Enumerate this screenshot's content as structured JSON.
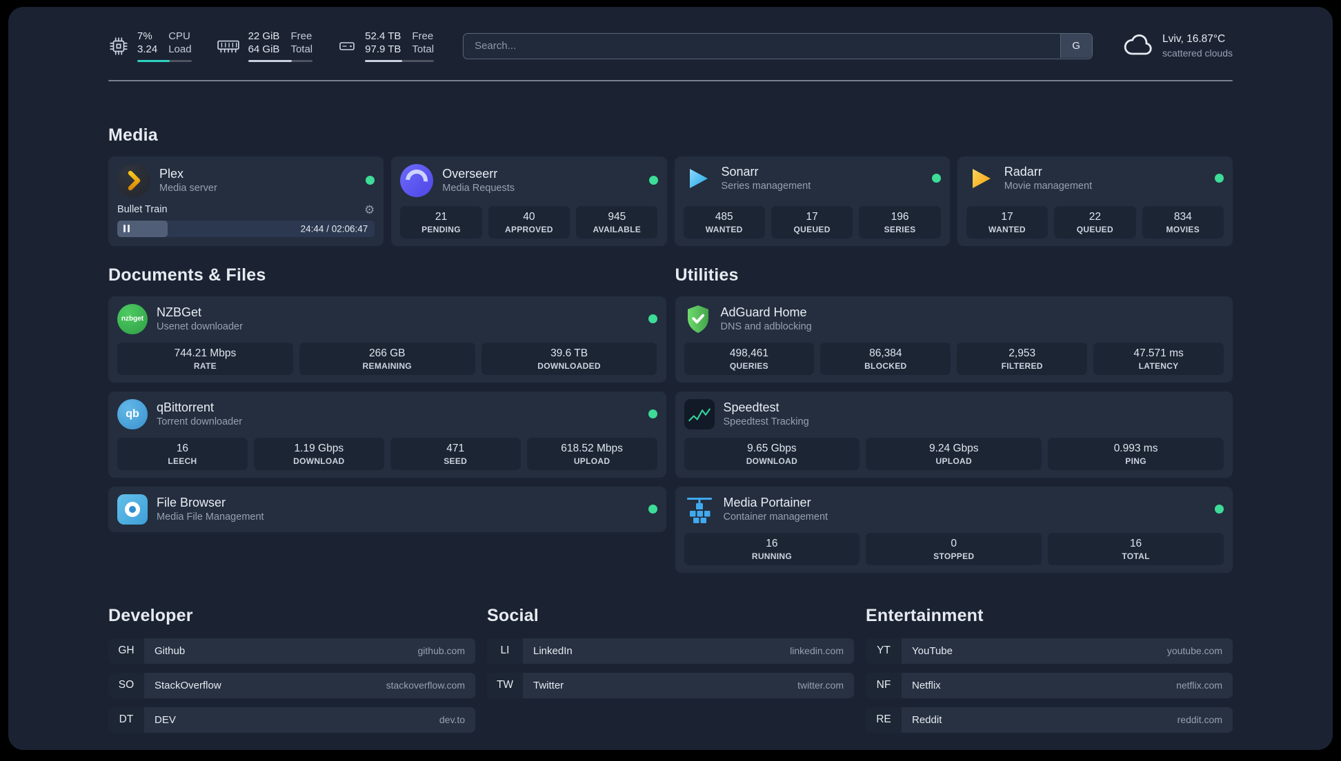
{
  "topbar": {
    "cpu": {
      "value1": "7%",
      "value2": "3.24",
      "label1": "CPU",
      "label2": "Load",
      "bar_pct": 60
    },
    "memory": {
      "value1": "22 GiB",
      "value2": "64 GiB",
      "label1": "Free",
      "label2": "Total",
      "bar_pct": 68
    },
    "disk": {
      "value1": "52.4 TB",
      "value2": "97.9 TB",
      "label1": "Free",
      "label2": "Total",
      "bar_pct": 54
    },
    "search": {
      "placeholder": "Search...",
      "provider_label": "G"
    },
    "weather": {
      "location": "Lviv, 16.87°C",
      "condition": "scattered clouds"
    }
  },
  "media": {
    "title": "Media",
    "plex": {
      "name": "Plex",
      "desc": "Media server",
      "now_playing": "Bullet Train",
      "time": "24:44 / 02:06:47",
      "progress_pct": 19.5
    },
    "overseerr": {
      "name": "Overseerr",
      "desc": "Media Requests",
      "stats": [
        {
          "value": "21",
          "label": "PENDING"
        },
        {
          "value": "40",
          "label": "APPROVED"
        },
        {
          "value": "945",
          "label": "AVAILABLE"
        }
      ]
    },
    "sonarr": {
      "name": "Sonarr",
      "desc": "Series management",
      "stats": [
        {
          "value": "485",
          "label": "WANTED"
        },
        {
          "value": "17",
          "label": "QUEUED"
        },
        {
          "value": "196",
          "label": "SERIES"
        }
      ]
    },
    "radarr": {
      "name": "Radarr",
      "desc": "Movie management",
      "stats": [
        {
          "value": "17",
          "label": "WANTED"
        },
        {
          "value": "22",
          "label": "QUEUED"
        },
        {
          "value": "834",
          "label": "MOVIES"
        }
      ]
    }
  },
  "documents": {
    "title": "Documents & Files",
    "nzbget": {
      "name": "NZBGet",
      "desc": "Usenet downloader",
      "stats": [
        {
          "value": "744.21 Mbps",
          "label": "RATE"
        },
        {
          "value": "266 GB",
          "label": "REMAINING"
        },
        {
          "value": "39.6 TB",
          "label": "DOWNLOADED"
        }
      ]
    },
    "qbittorrent": {
      "name": "qBittorrent",
      "desc": "Torrent downloader",
      "stats": [
        {
          "value": "16",
          "label": "LEECH"
        },
        {
          "value": "1.19 Gbps",
          "label": "DOWNLOAD"
        },
        {
          "value": "471",
          "label": "SEED"
        },
        {
          "value": "618.52 Mbps",
          "label": "UPLOAD"
        }
      ]
    },
    "filebrowser": {
      "name": "File Browser",
      "desc": "Media File Management"
    }
  },
  "utilities": {
    "title": "Utilities",
    "adguard": {
      "name": "AdGuard Home",
      "desc": "DNS and adblocking",
      "stats": [
        {
          "value": "498,461",
          "label": "QUERIES"
        },
        {
          "value": "86,384",
          "label": "BLOCKED"
        },
        {
          "value": "2,953",
          "label": "FILTERED"
        },
        {
          "value": "47.571 ms",
          "label": "LATENCY"
        }
      ]
    },
    "speedtest": {
      "name": "Speedtest",
      "desc": "Speedtest Tracking",
      "stats": [
        {
          "value": "9.65 Gbps",
          "label": "DOWNLOAD"
        },
        {
          "value": "9.24 Gbps",
          "label": "UPLOAD"
        },
        {
          "value": "0.993 ms",
          "label": "PING"
        }
      ]
    },
    "portainer": {
      "name": "Media Portainer",
      "desc": "Container management",
      "stats": [
        {
          "value": "16",
          "label": "RUNNING"
        },
        {
          "value": "0",
          "label": "STOPPED"
        },
        {
          "value": "16",
          "label": "TOTAL"
        }
      ]
    }
  },
  "bookmarks": {
    "developer": {
      "title": "Developer",
      "items": [
        {
          "abbr": "GH",
          "name": "Github",
          "domain": "github.com"
        },
        {
          "abbr": "SO",
          "name": "StackOverflow",
          "domain": "stackoverflow.com"
        },
        {
          "abbr": "DT",
          "name": "DEV",
          "domain": "dev.to"
        }
      ]
    },
    "social": {
      "title": "Social",
      "items": [
        {
          "abbr": "LI",
          "name": "LinkedIn",
          "domain": "linkedin.com"
        },
        {
          "abbr": "TW",
          "name": "Twitter",
          "domain": "twitter.com"
        }
      ]
    },
    "entertainment": {
      "title": "Entertainment",
      "items": [
        {
          "abbr": "YT",
          "name": "YouTube",
          "domain": "youtube.com"
        },
        {
          "abbr": "NF",
          "name": "Netflix",
          "domain": "netflix.com"
        },
        {
          "abbr": "RE",
          "name": "Reddit",
          "domain": "reddit.com"
        }
      ]
    }
  },
  "icon_text": {
    "nzbget": "nzbget",
    "qb": "qb",
    "gear": "⚙"
  },
  "colors": {
    "accent_green": "#3ddc97",
    "cpu_bar": "#2dd4bf",
    "background": "#1b2333",
    "card": "#242e3f"
  }
}
